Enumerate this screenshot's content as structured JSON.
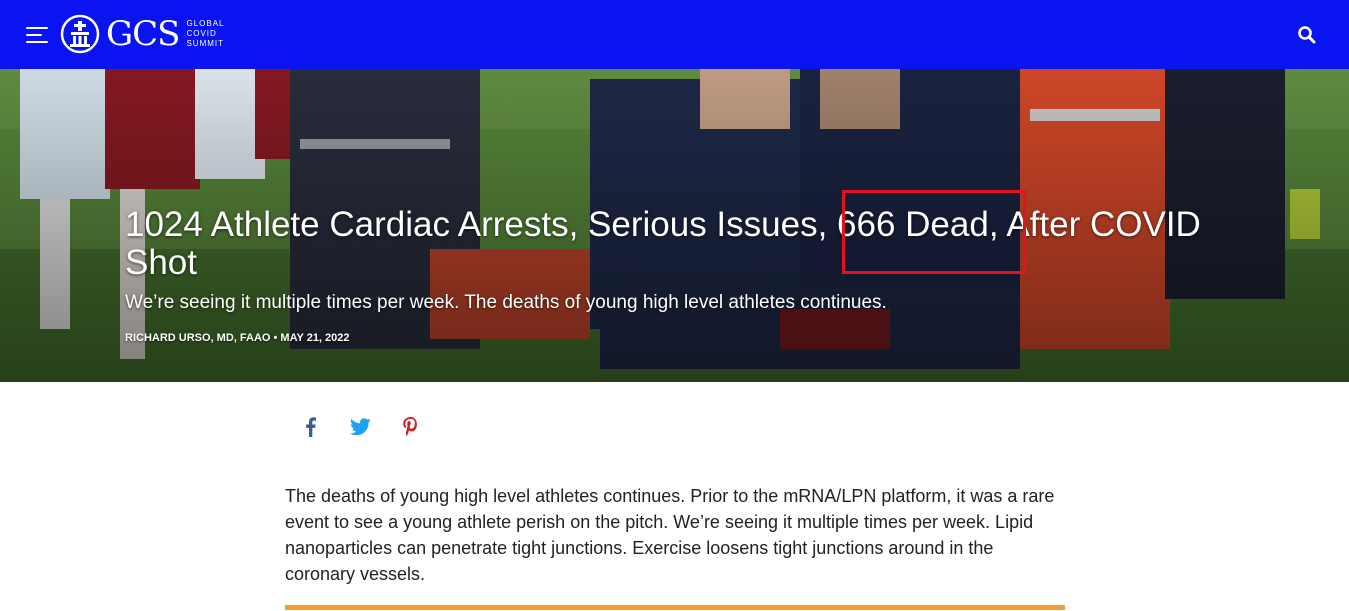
{
  "colors": {
    "brand": "#0a14f0",
    "annotation": "#e0141e",
    "accent": "#f59a3b",
    "facebook": "#3b5998",
    "twitter": "#1da1f2",
    "pinterest": "#cb2027"
  },
  "header": {
    "logo_text": "GCS",
    "logo_sub": [
      "GLOBAL",
      "COVID",
      "SUMMIT"
    ],
    "menu_icon": "hamburger-menu-icon",
    "search_icon": "search-icon"
  },
  "hero": {
    "title": "1024 Athlete Cardiac Arrests, Serious Issues, 666 Dead, After COVID Shot",
    "subtitle": "We’re seeing it multiple times per week. The deaths of young high level athletes continues.",
    "byline": "RICHARD URSO, MD, FAAO • MAY 21, 2022"
  },
  "share": {
    "items": [
      {
        "icon": "facebook-icon"
      },
      {
        "icon": "twitter-icon"
      },
      {
        "icon": "pinterest-icon"
      }
    ]
  },
  "article": {
    "paragraph_1": "The deaths of young high level athletes continues. Prior to the mRNA/LPN platform, it was a rare event to see a young athlete perish on the pitch. We’re seeing it multiple times per week. Lipid nanoparticles can penetrate tight junctions. Exercise loosens tight junctions around in the coronary vessels."
  }
}
